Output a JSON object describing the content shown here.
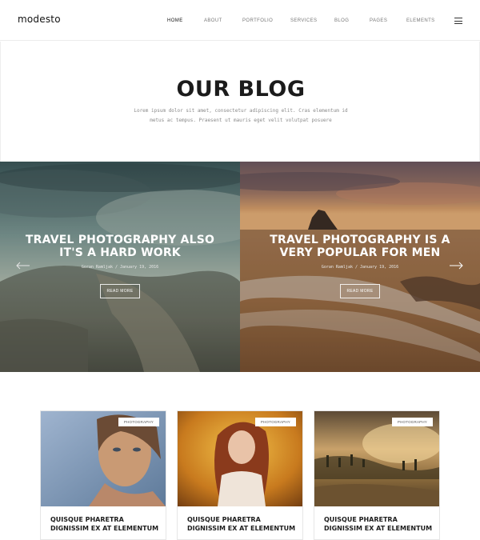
{
  "header": {
    "logo": "modesto",
    "nav": [
      "HOME",
      "ABOUT",
      "PORTFOLIO",
      "SERVICES",
      "BLOG",
      "PAGES",
      "ELEMENTS"
    ],
    "menu_icon": "hamburger-menu-icon"
  },
  "hero": {
    "title": "OUR BLOG",
    "text": "Lorem ipsum dolor sit amet, consectetur adipiscing elit. Cras elementum id metus ac tempus. Praesent ut mauris eget velit volutpat posuere"
  },
  "slider": {
    "slides": [
      {
        "title": "TRAVEL PHOTOGRAPHY ALSO IT'S A HARD WORK",
        "meta": "Goran Ramljak / January 19, 2016",
        "button": "READ MORE"
      },
      {
        "title": "TRAVEL PHOTOGRAPHY IS A VERY POPULAR FOR MEN",
        "meta": "Goran Ramljak / January 19, 2016",
        "button": "READ MORE"
      }
    ],
    "prev_icon": "arrow-left-icon",
    "next_icon": "arrow-right-icon"
  },
  "cards": [
    {
      "badge": "PHOTOGRAPHY",
      "title": "QUISQUE PHARETRA DIGNISSIM EX AT ELEMENTUM"
    },
    {
      "badge": "PHOTOGRAPHY",
      "title": "QUISQUE PHARETRA DIGNISSIM EX AT ELEMENTUM"
    },
    {
      "badge": "PHOTOGRAPHY",
      "title": "QUISQUE PHARETRA DIGNISSIM EX AT ELEMENTUM"
    }
  ]
}
